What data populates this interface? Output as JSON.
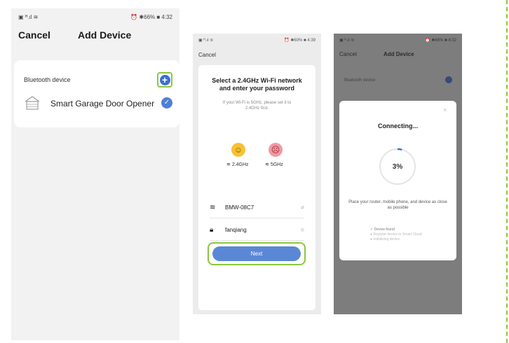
{
  "screen1": {
    "status_left": "▣ ᴴ.ıl ≋",
    "status_right": "⏰ ✱66% ■ 4:32",
    "cancel": "Cancel",
    "title": "Add Device",
    "bluetooth_label": "Bluetooth device",
    "device_name": "Smart Garage Door Opener"
  },
  "screen2": {
    "status_left": "▣ ᴴ.ıl ≋",
    "status_right": "⏰ ✱60% ■ 4:39",
    "cancel": "Cancel",
    "heading_line1": "Select a 2.4GHz Wi-Fi network",
    "heading_line2": "and enter your password",
    "sub_line1": "If your Wi-Fi is 5GHz, please set it to",
    "sub_line2": "2.4GHz first.",
    "band_good": "2.4GHz",
    "band_bad": "5GHz",
    "wifi_name": "BMW-08C7",
    "wifi_tail": "⇄",
    "password": "fanqiang",
    "password_tail": "◎",
    "next_label": "Next"
  },
  "screen3": {
    "status_left": "▣ ᴴ.ıl ≋",
    "status_right": "⏰ ✱66% ■ 4:32",
    "cancel": "Cancel",
    "title": "Add Device",
    "bluetooth_label": "Bluetooth device",
    "close": "×",
    "connecting": "Connecting...",
    "progress": "3%",
    "progress_fraction": 0.03,
    "place_line1": "Place your router, mobile phone, and device as close",
    "place_line2": "as possible",
    "step1": "✓  Device found",
    "step2": "●  Register device to Smart Cloud",
    "step3": "●  Initializing device."
  },
  "colors": {
    "accent_blue": "#3a6fd1",
    "highlight_green": "#8cc63f"
  }
}
